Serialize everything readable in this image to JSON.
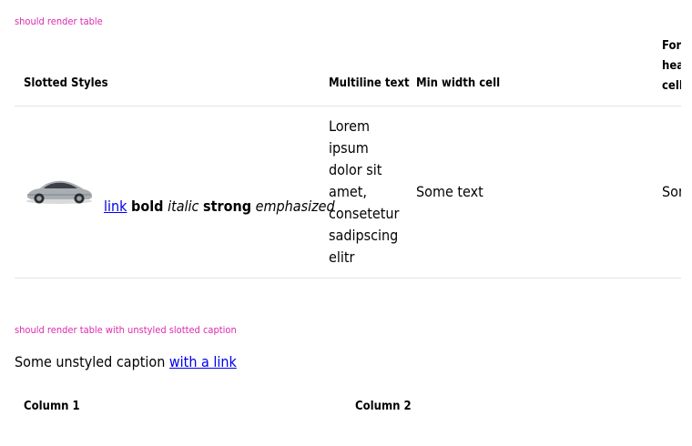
{
  "section1": {
    "title": "should render table",
    "headers": {
      "slotted_styles": "Slotted Styles",
      "multiline_text": "Multiline text",
      "min_width_cell": "Min width cell",
      "forced_header_line1": "Forced",
      "forced_header_line2": "header",
      "forced_header_line3": "cell"
    },
    "row": {
      "image_icon": "car-image",
      "link": "link",
      "bold": "bold",
      "italic": "italic",
      "strong": "strong",
      "emphasized": "emphasized",
      "multiline_lines": [
        "Lorem",
        "ipsum",
        "dolor sit",
        "amet,",
        "consetetur",
        "sadipscing",
        "elitr"
      ],
      "min_width_text": "Some text",
      "forced_text": "Some text"
    }
  },
  "section2": {
    "title": "should render table with unstyled slotted caption",
    "caption_text": "Some unstyled caption",
    "caption_link": "with a link",
    "headers": {
      "col1": "Column 1",
      "col2": "Column 2"
    }
  },
  "colors": {
    "section_title": "#de2aae",
    "link": "#0000ee",
    "border": "#e2e2e2"
  }
}
